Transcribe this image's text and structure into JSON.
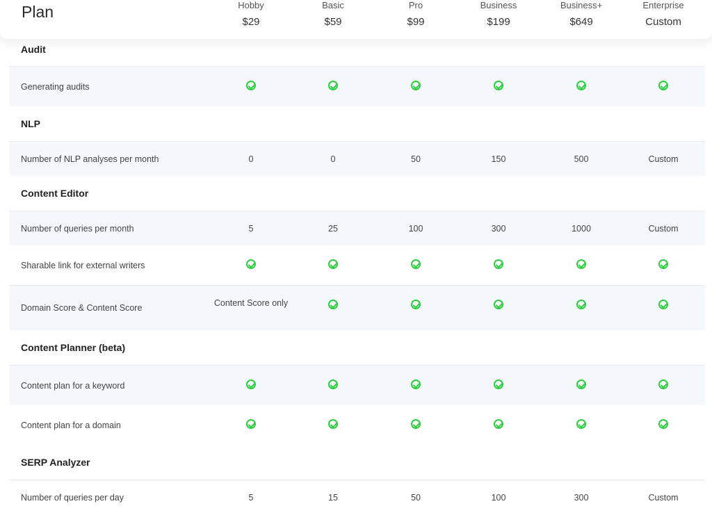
{
  "header": {
    "title": "Plan",
    "plans": [
      {
        "name": "Hobby",
        "price": "$29"
      },
      {
        "name": "Basic",
        "price": "$59"
      },
      {
        "name": "Pro",
        "price": "$99"
      },
      {
        "name": "Business",
        "price": "$199"
      },
      {
        "name": "Business+",
        "price": "$649"
      },
      {
        "name": "Enterprise",
        "price": "Custom"
      }
    ]
  },
  "sections": {
    "audit": "Audit",
    "nlp": "NLP",
    "content_editor": "Content Editor",
    "content_planner": "Content Planner (beta)",
    "serp_analyzer": "SERP Analyzer"
  },
  "rows": {
    "generating_audits": {
      "label": "Generating audits",
      "values": [
        "check",
        "check",
        "check",
        "check",
        "check",
        "check"
      ]
    },
    "nlp_analyses": {
      "label": "Number of NLP analyses per month",
      "values": [
        "0",
        "0",
        "50",
        "150",
        "500",
        "Custom"
      ]
    },
    "ce_queries": {
      "label": "Number of queries per month",
      "values": [
        "5",
        "25",
        "100",
        "300",
        "1000",
        "Custom"
      ]
    },
    "sharable_link": {
      "label": "Sharable link for external writers",
      "values": [
        "check",
        "check",
        "check",
        "check",
        "check",
        "check"
      ]
    },
    "domain_score": {
      "label": "Domain Score & Content Score",
      "values": [
        "Content Score only",
        "check",
        "check",
        "check",
        "check",
        "check"
      ]
    },
    "plan_keyword": {
      "label": "Content plan for a keyword",
      "values": [
        "check",
        "check",
        "check",
        "check",
        "check",
        "check"
      ]
    },
    "plan_domain": {
      "label": "Content plan for a domain",
      "values": [
        "check",
        "check",
        "check",
        "check",
        "check",
        "check"
      ]
    },
    "serp_queries": {
      "label": "Number of queries per day",
      "values": [
        "5",
        "15",
        "50",
        "100",
        "300",
        "Custom"
      ]
    }
  },
  "colors": {
    "check": "#2ecc40",
    "alt_row": "#f5f8fb"
  }
}
